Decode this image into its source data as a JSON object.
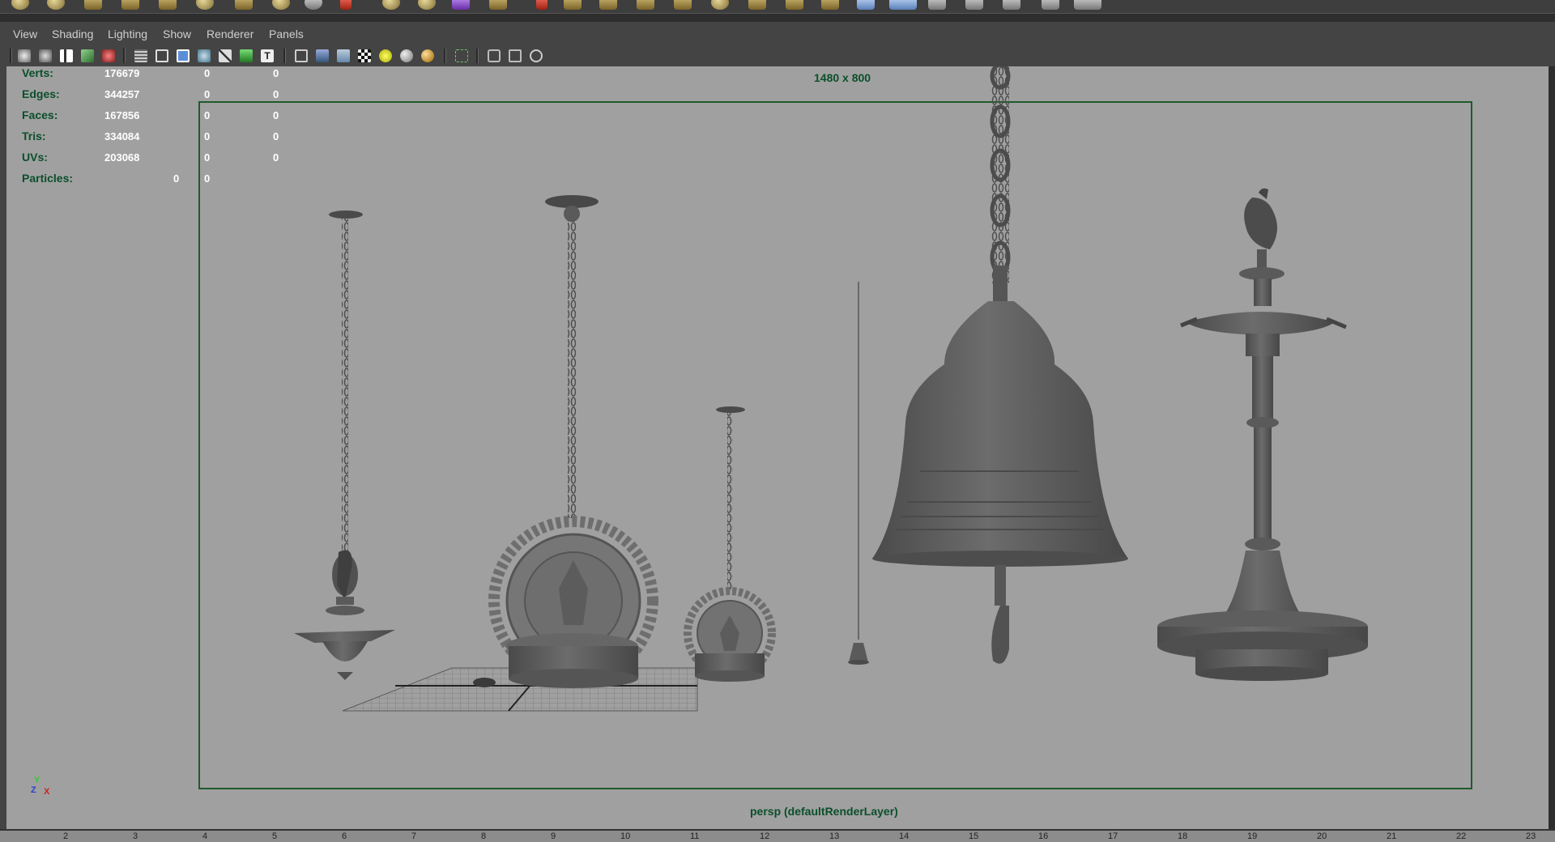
{
  "panel_menu": [
    "View",
    "Shading",
    "Lighting",
    "Show",
    "Renderer",
    "Panels"
  ],
  "hud": {
    "rows": [
      {
        "label": "Verts:",
        "total": "176679",
        "selected": "0",
        "components": "0"
      },
      {
        "label": "Edges:",
        "total": "344257",
        "selected": "0",
        "components": "0"
      },
      {
        "label": "Faces:",
        "total": "167856",
        "selected": "0",
        "components": "0"
      },
      {
        "label": "Tris:",
        "total": "334084",
        "selected": "0",
        "components": "0"
      },
      {
        "label": "UVs:",
        "total": "203068",
        "selected": "0",
        "components": "0"
      }
    ],
    "particles": {
      "label": "Particles:",
      "total": "0",
      "selected": "0"
    }
  },
  "resolution_gate_label": "1480 x 800",
  "camera_label": "persp (defaultRenderLayer)",
  "axis": {
    "y": "Y",
    "x": "X",
    "z": "Z"
  },
  "time_ticks": [
    "2",
    "3",
    "4",
    "5",
    "6",
    "7",
    "8",
    "9",
    "10",
    "11",
    "12",
    "13",
    "14",
    "15",
    "16",
    "17",
    "18",
    "19",
    "20",
    "21",
    "22",
    "23"
  ],
  "colors": {
    "hud_label": "#0b4f2b",
    "hud_value": "#ffffff",
    "viewport_bg": "#a0a0a0",
    "gate_border": "#1f5a2c",
    "model_gray": "#5e5e5e"
  },
  "toolbar_icons": [
    "camera-select-icon",
    "camera-attributes-icon",
    "bookmark-icon",
    "image-plane-icon",
    "grease-pencil-icon",
    "grid-icon",
    "film-gate-icon",
    "resolution-gate-icon",
    "gate-mask-icon",
    "field-chart-icon",
    "safe-action-icon",
    "safe-title-icon",
    "wireframe-icon",
    "smooth-shade-icon",
    "default-material-icon",
    "textured-icon",
    "lights-icon",
    "shadows-icon",
    "ambient-occlusion-icon",
    "select-highlight-icon",
    "isolate-select-icon",
    "xray-icon",
    "xray-joints-icon"
  ]
}
